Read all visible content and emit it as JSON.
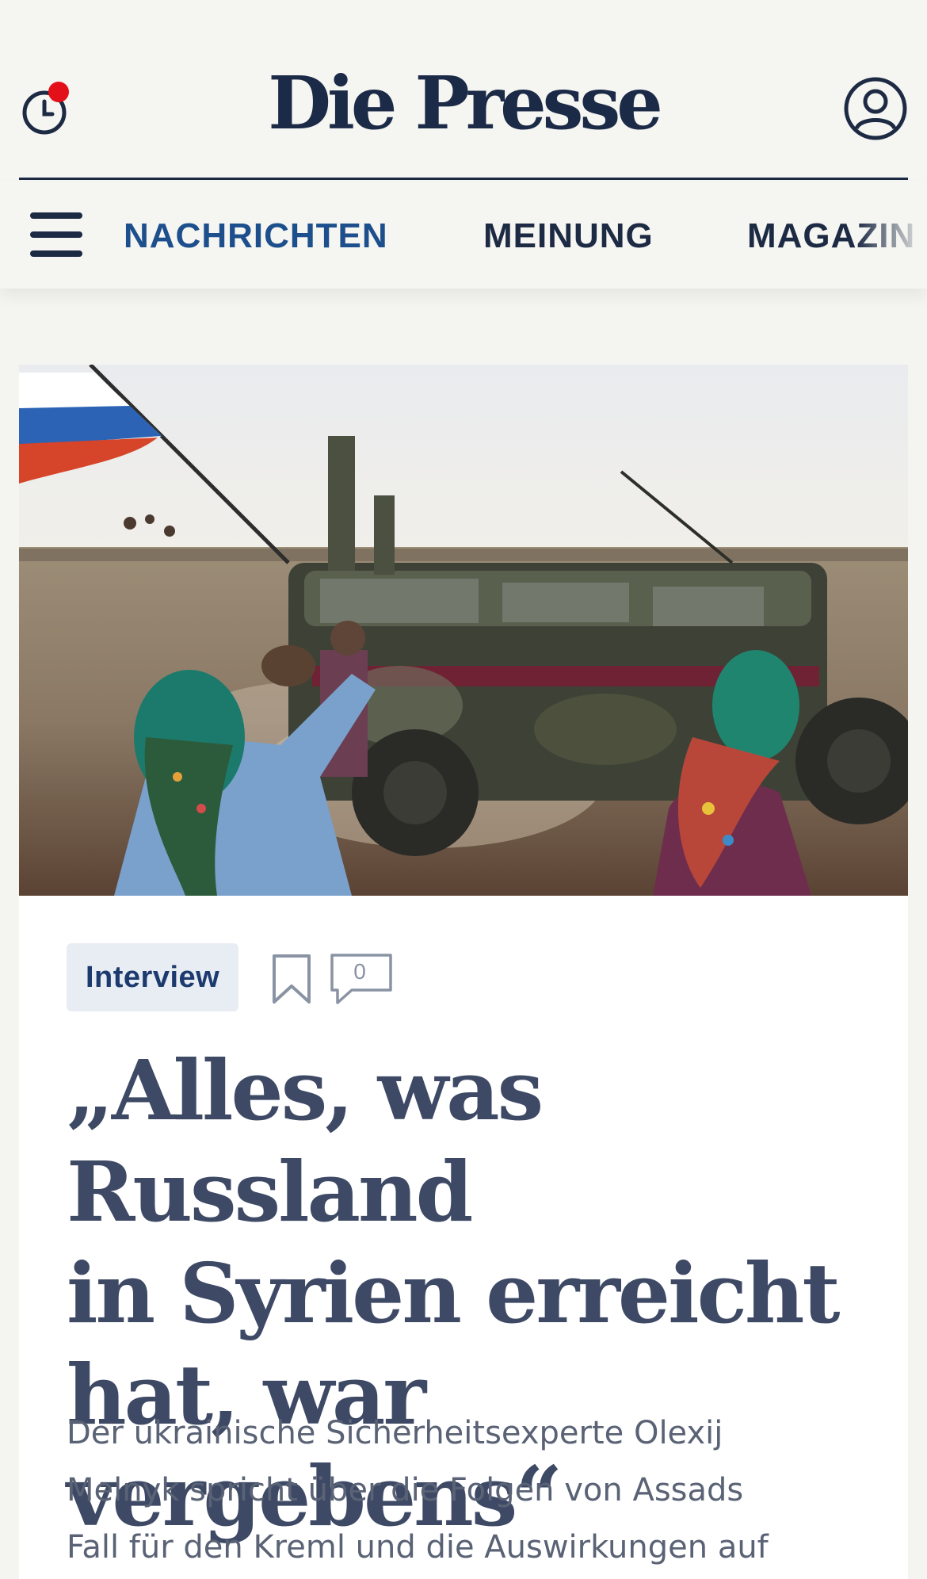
{
  "header": {
    "logo": "Die Presse",
    "history_icon": "history-clock-icon",
    "notification_dot_color": "#e3101a",
    "account_icon": "user-account-icon"
  },
  "nav": {
    "menu_icon": "hamburger-menu-icon",
    "items": [
      {
        "label": "NACHRICHTEN",
        "active": true,
        "color": "#1d4f8c"
      },
      {
        "label": "MEINUNG",
        "active": false,
        "color": "#1d2a44"
      },
      {
        "label": "MAGAZIN",
        "active": false,
        "color": "#1d2a44"
      }
    ]
  },
  "article": {
    "image_icon": "hero-photo",
    "tag": "Interview",
    "bookmark_icon": "bookmark-icon",
    "comment_icon": "comment-icon",
    "comment_count": "0",
    "headline_lines": [
      "„Alles, was Russland",
      "in Syrien erreicht",
      "hat, war vergebens“"
    ],
    "lead_lines": [
      "Der ukrainische Sicherheitsexperte Olexij",
      "Melnyk spricht über die Folgen von Assads",
      "Fall für den Kreml und die Auswirkungen auf"
    ]
  },
  "colors": {
    "brand_navy": "#1b2a47",
    "accent_blue": "#1d4f8c",
    "page_bg": "#f4f4f1",
    "tag_bg": "#e8edf4"
  }
}
